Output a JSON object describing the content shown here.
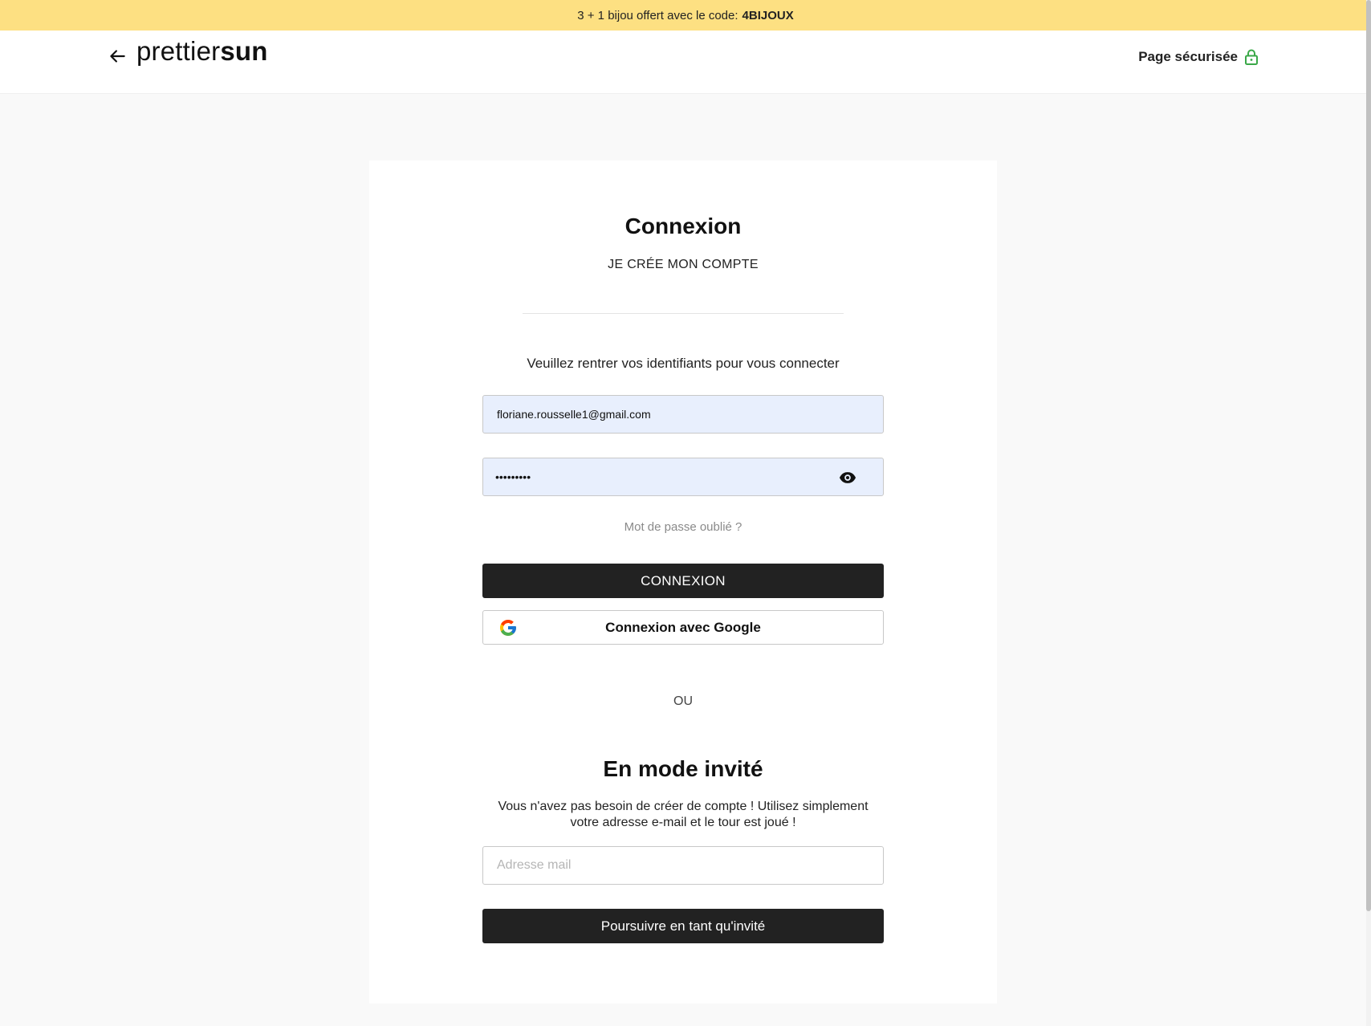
{
  "promo": {
    "text": "3 + 1 bijou offert avec le code:",
    "code": "4BIJOUX"
  },
  "header": {
    "logo_light": "prettier",
    "logo_bold": "sun",
    "secure_label": "Page sécurisée"
  },
  "login": {
    "title": "Connexion",
    "create_account": "JE CRÉE MON COMPTE",
    "instructions": "Veuillez rentrer vos identifiants pour vous connecter",
    "email_value": "floriane.rousselle1@gmail.com",
    "password_value": "•••••••••",
    "forgot_password": "Mot de passe oublié ?",
    "submit_label": "CONNEXION",
    "google_label": "Connexion avec Google"
  },
  "separator": "OU",
  "guest": {
    "title": "En mode invité",
    "description": "Vous n'avez pas besoin de créer de compte ! Utilisez simplement votre adresse e-mail et le tour est joué !",
    "email_placeholder": "Adresse mail",
    "submit_label": "Poursuivre en tant qu'invité"
  },
  "colors": {
    "promo_bg": "#fde082",
    "button_dark": "#222222",
    "lock_green": "#3aa848",
    "input_filled_bg": "#e8effd"
  },
  "icons": [
    "arrow-left-icon",
    "lock-icon",
    "eye-icon",
    "google-icon"
  ]
}
